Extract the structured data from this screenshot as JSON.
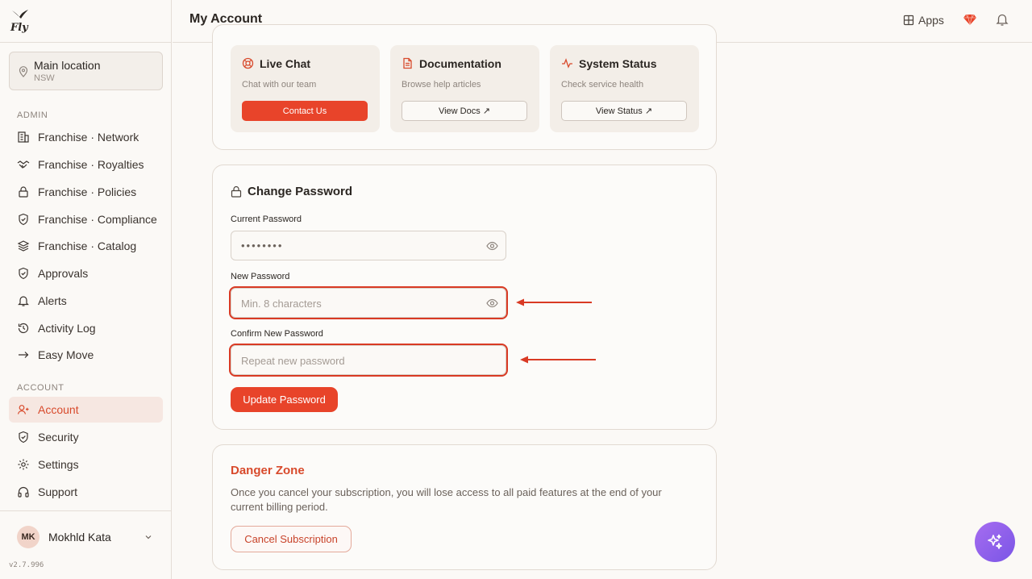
{
  "brand": {
    "logo_text": "Fly",
    "accent": "#e8442a"
  },
  "location": {
    "title": "Main location",
    "subtitle": "NSW"
  },
  "sidebar": {
    "admin_label": "ADMIN",
    "admin_items": [
      {
        "label": "Franchise · Network",
        "icon": "building-icon"
      },
      {
        "label": "Franchise · Royalties",
        "icon": "handshake-icon"
      },
      {
        "label": "Franchise · Policies",
        "icon": "lock-icon"
      },
      {
        "label": "Franchise · Compliance",
        "icon": "shield-icon"
      },
      {
        "label": "Franchise · Catalog",
        "icon": "layers-icon"
      },
      {
        "label": "Approvals",
        "icon": "shield-check-icon"
      },
      {
        "label": "Alerts",
        "icon": "bell-icon"
      },
      {
        "label": "Activity Log",
        "icon": "history-icon"
      },
      {
        "label": "Easy Move",
        "icon": "arrow-right-icon"
      }
    ],
    "account_label": "ACCOUNT",
    "account_items": [
      {
        "label": "Account",
        "icon": "user-icon",
        "active": true
      },
      {
        "label": "Security",
        "icon": "shield-icon"
      },
      {
        "label": "Settings",
        "icon": "gear-icon"
      },
      {
        "label": "Support",
        "icon": "headphones-icon"
      }
    ]
  },
  "user": {
    "initials": "MK",
    "name": "Mokhld Kata"
  },
  "version": "v2.7.996",
  "header": {
    "title": "My Account",
    "apps_label": "Apps"
  },
  "support": {
    "cards": [
      {
        "title": "Live Chat",
        "subtitle": "Chat with our team",
        "button": "Contact Us",
        "icon": "lifebuoy-icon"
      },
      {
        "title": "Documentation",
        "subtitle": "Browse help articles",
        "button": "View Docs ↗",
        "icon": "document-icon"
      },
      {
        "title": "System Status",
        "subtitle": "Check service health",
        "button": "View Status ↗",
        "icon": "activity-icon"
      }
    ]
  },
  "change_password": {
    "title": "Change Password",
    "current_label": "Current Password",
    "current_value": "••••••••",
    "new_label": "New Password",
    "new_placeholder": "Min. 8 characters",
    "confirm_label": "Confirm New Password",
    "confirm_placeholder": "Repeat new password",
    "submit": "Update Password"
  },
  "danger_zone": {
    "title": "Danger Zone",
    "text": "Once you cancel your subscription, you will lose access to all paid features at the end of your current billing period.",
    "button": "Cancel Subscription"
  },
  "colors": {
    "highlight": "#d93a24",
    "fab_gradient_start": "#a66df0",
    "fab_gradient_end": "#7a55e6"
  }
}
